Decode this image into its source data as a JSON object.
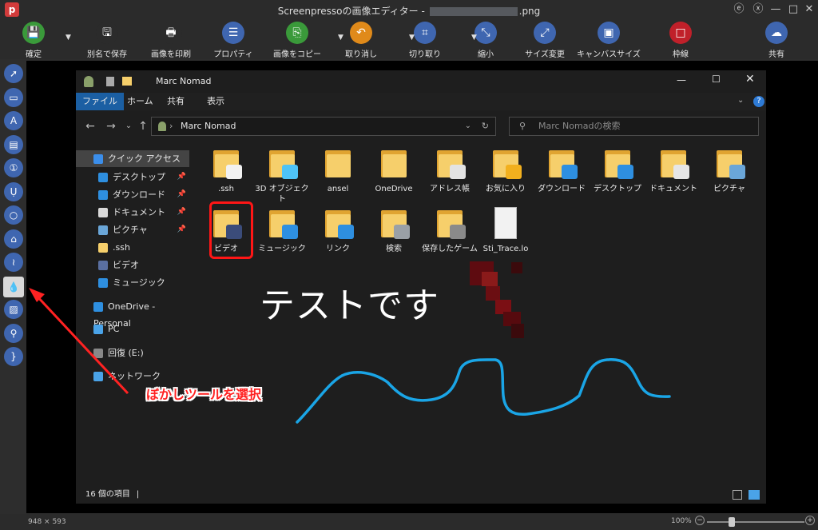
{
  "window": {
    "app_icon": "p",
    "title_prefix": "Screenpressoの画像エディター - ",
    "title_suffix": ".png",
    "controls": [
      "ⓔ",
      "ⓧ",
      "—",
      "□",
      "✕"
    ]
  },
  "toolbar": {
    "items": [
      {
        "label": "確定",
        "icon": "save-icon",
        "color": "#3a9a3a",
        "glyph": "💾"
      },
      {
        "label": "別名で保存",
        "icon": "save-as-icon",
        "color": "#2b2b2b",
        "glyph": "🖫"
      },
      {
        "label": "画像を印刷",
        "icon": "print-icon",
        "color": "#2b2b2b",
        "glyph": "🖶"
      },
      {
        "label": "プロパティ",
        "icon": "properties-icon",
        "color": "#3f66b0",
        "glyph": "☰"
      },
      {
        "label": "画像をコピー",
        "icon": "copy-icon",
        "color": "#3a9a3a",
        "glyph": "⎘"
      },
      {
        "label": "取り消し",
        "icon": "undo-icon",
        "color": "#e08a1a",
        "glyph": "↶"
      },
      {
        "label": "切り取り",
        "icon": "crop-icon",
        "color": "#3f66b0",
        "glyph": "⌗"
      },
      {
        "label": "縮小",
        "icon": "shrink-icon",
        "color": "#3f66b0",
        "glyph": "⤡"
      },
      {
        "label": "サイズ変更",
        "icon": "resize-icon",
        "color": "#3f66b0",
        "glyph": "⤢"
      },
      {
        "label": "キャンバスサイズ",
        "icon": "canvas-size-icon",
        "color": "#3f66b0",
        "glyph": "▣"
      },
      {
        "label": "枠線",
        "icon": "border-icon",
        "color": "#c0202a",
        "glyph": "□"
      },
      {
        "label": "共有",
        "icon": "share-icon",
        "color": "#3f66b0",
        "glyph": "☁"
      }
    ]
  },
  "sidebar": {
    "tools": [
      {
        "name": "arrow-tool-icon",
        "glyph": "➚"
      },
      {
        "name": "rectangle-tool-icon",
        "glyph": "▭"
      },
      {
        "name": "text-tool-icon",
        "glyph": "A"
      },
      {
        "name": "callout-tool-icon",
        "glyph": "▤"
      },
      {
        "name": "step-tool-icon",
        "glyph": "①"
      },
      {
        "name": "highlight-tool-icon",
        "glyph": "Ụ"
      },
      {
        "name": "ellipse-tool-icon",
        "glyph": "○"
      },
      {
        "name": "shape-tool-icon",
        "glyph": "⌂"
      },
      {
        "name": "freehand-tool-icon",
        "glyph": "≀"
      },
      {
        "name": "blur-tool-icon",
        "glyph": "💧"
      },
      {
        "name": "image-tool-icon",
        "glyph": "▨"
      },
      {
        "name": "magnifier-tool-icon",
        "glyph": "⚲"
      },
      {
        "name": "bracket-tool-icon",
        "glyph": "}"
      }
    ]
  },
  "explorer": {
    "title": "Marc Nomad",
    "ribbon_tabs": [
      "ファイル",
      "ホーム",
      "共有",
      "表示"
    ],
    "address": "Marc Nomad",
    "search_placeholder": "Marc Nomadの検索",
    "nav": [
      {
        "label": "クイック アクセス",
        "pin": false,
        "color": "#3b8eea",
        "sel": true
      },
      {
        "label": "デスクトップ",
        "pin": true,
        "color": "#2e8fe0"
      },
      {
        "label": "ダウンロード",
        "pin": true,
        "color": "#2e8fe0"
      },
      {
        "label": "ドキュメント",
        "pin": true,
        "color": "#d9d9d9"
      },
      {
        "label": "ピクチャ",
        "pin": true,
        "color": "#6aa6d8"
      },
      {
        "label": ".ssh",
        "pin": false,
        "color": "#f6cf6b"
      },
      {
        "label": "ビデオ",
        "pin": false,
        "color": "#5a6fa0"
      },
      {
        "label": "ミュージック",
        "pin": false,
        "color": "#2e8fe0"
      },
      {
        "label": "OneDrive - Personal",
        "pin": false,
        "color": "#2e8fe0"
      },
      {
        "label": "PC",
        "pin": false,
        "color": "#4aa3e8"
      },
      {
        "label": "回復 (E:)",
        "pin": false,
        "color": "#888888"
      },
      {
        "label": "ネットワーク",
        "pin": false,
        "color": "#4aa3e8"
      }
    ],
    "files_row1": [
      {
        "label": ".ssh",
        "overlay": "#f2f2f2"
      },
      {
        "label": "3D オブジェクト",
        "overlay": "#4fc3f7"
      },
      {
        "label": "ansel",
        "overlay": ""
      },
      {
        "label": "OneDrive",
        "overlay": ""
      },
      {
        "label": "アドレス帳",
        "overlay": "#e3e3e3"
      },
      {
        "label": "お気に入り",
        "overlay": "#f2b01e"
      },
      {
        "label": "ダウンロード",
        "overlay": "#2e8fe0"
      },
      {
        "label": "デスクトップ",
        "overlay": "#2e8fe0"
      },
      {
        "label": "ドキュメント",
        "overlay": "#e6e6e6"
      },
      {
        "label": "ピクチャ",
        "overlay": "#6aa6d8"
      }
    ],
    "files_row2": [
      {
        "label": "ビデオ",
        "overlay": "#3b4c7a"
      },
      {
        "label": "ミュージック",
        "overlay": "#2e8fe0"
      },
      {
        "label": "リンク",
        "overlay": "#2e8fe0"
      },
      {
        "label": "検索",
        "overlay": "#9aa0a6"
      },
      {
        "label": "保存したゲーム",
        "overlay": "#8a8a8a"
      },
      {
        "label": "Sti_Trace.lo",
        "overlay": "page"
      }
    ],
    "status": "16 個の項目"
  },
  "annotations": {
    "big_text": "テストです",
    "callout_text": "ぼかしツールを選択",
    "line_color": "#1aa5e6",
    "arrow_color": "#ff2222"
  },
  "statusbar": {
    "dimensions": "948 × 593",
    "zoom": "100%"
  }
}
